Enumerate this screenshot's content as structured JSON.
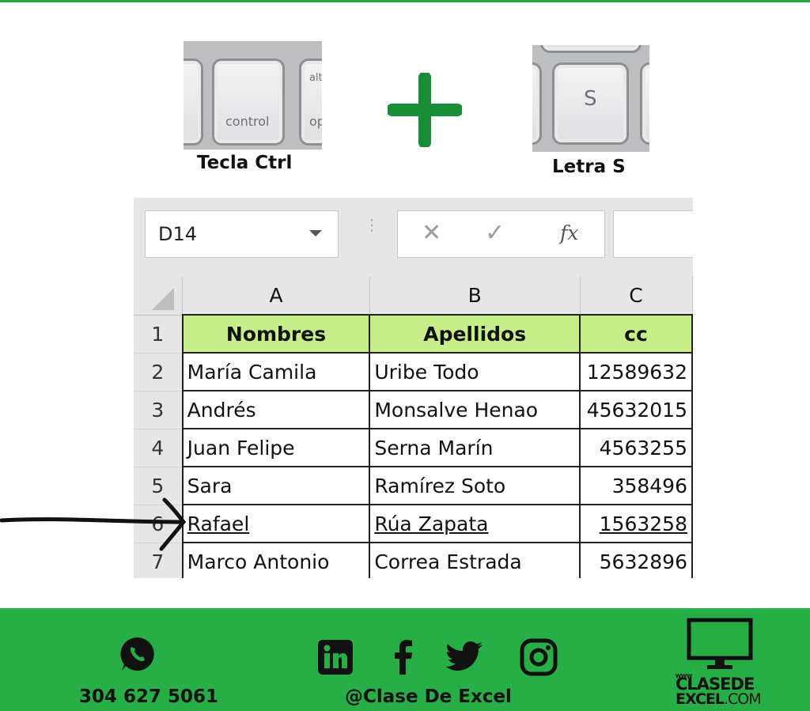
{
  "keys": {
    "ctrl": {
      "label": "Tecla Ctrl",
      "cap_text": "control",
      "side_top": "alt",
      "side_bottom": "op"
    },
    "s": {
      "label": "Letra S",
      "cap_text": "S"
    },
    "operator_color": "#168d36"
  },
  "excel": {
    "name_box": "D14",
    "formula_buttons": {
      "cancel": "✕",
      "enter": "✓",
      "fx": "fx"
    },
    "columns": [
      "A",
      "B",
      "C"
    ],
    "rows": [
      {
        "num": "1",
        "a": "Nombres",
        "b": "Apellidos",
        "c": "cc"
      },
      {
        "num": "2",
        "a": "María Camila",
        "b": "Uribe Todo",
        "c": "12589632"
      },
      {
        "num": "3",
        "a": "Andrés",
        "b": "Monsalve Henao",
        "c": "45632015"
      },
      {
        "num": "4",
        "a": "Juan Felipe",
        "b": "Serna Marín",
        "c": "4563255"
      },
      {
        "num": "5",
        "a": "Sara",
        "b": "Ramírez Soto",
        "c": "358496"
      },
      {
        "num": "6",
        "a": "Rafael",
        "b": "Rúa Zapata",
        "c": "1563258"
      },
      {
        "num": "7",
        "a": "Marco Antonio",
        "b": "Correa Estrada",
        "c": "5632896"
      }
    ],
    "header_fill": "#c6ef8a"
  },
  "footer": {
    "phone": "304 627 5061",
    "handle": "@Clase De Excel",
    "brand_www": "www",
    "brand_line1": "CLASEDE",
    "brand_line2_bold": "EXCEL",
    "brand_line2_rest": ".COM",
    "icons": [
      "whatsapp-icon",
      "linkedin-icon",
      "facebook-icon",
      "twitter-icon",
      "instagram-icon",
      "monitor-icon"
    ],
    "background": "#27ae47"
  }
}
